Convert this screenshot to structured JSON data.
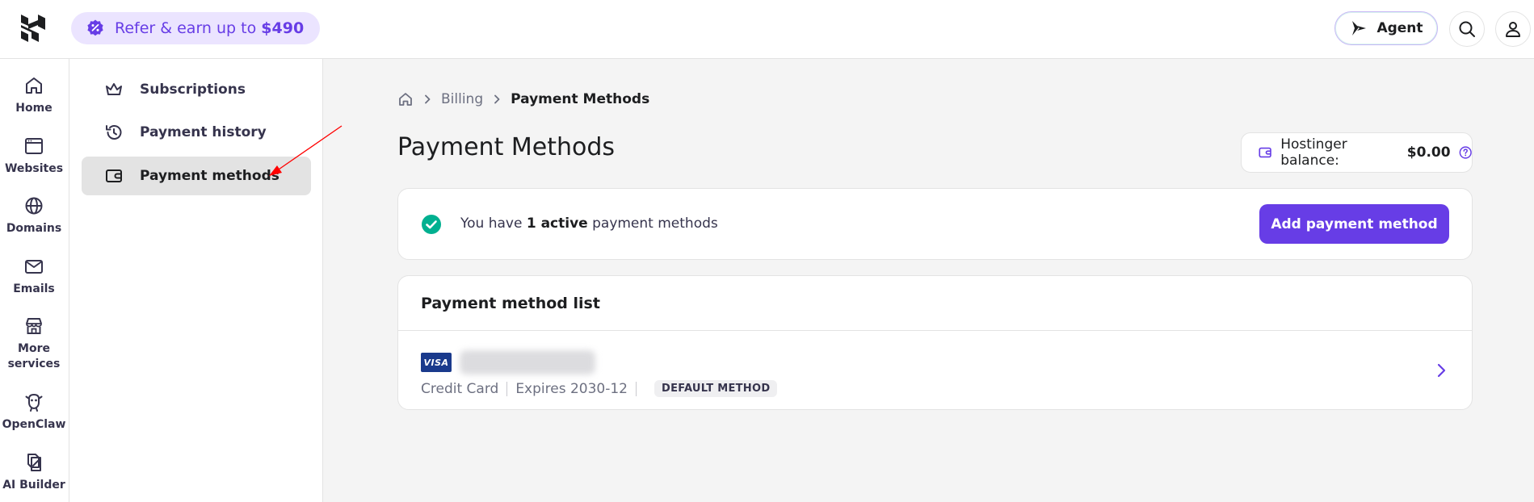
{
  "topbar": {
    "refer": {
      "prefix": "Refer & earn up to ",
      "amount": "$490"
    },
    "agent_label": "Agent"
  },
  "rail": {
    "items": [
      {
        "label": "Home",
        "icon": "home-icon"
      },
      {
        "label": "Websites",
        "icon": "browser-window-icon"
      },
      {
        "label": "Domains",
        "icon": "globe-icon"
      },
      {
        "label": "Emails",
        "icon": "mail-icon"
      },
      {
        "label": "More",
        "label2": "services",
        "icon": "store-icon"
      },
      {
        "label": "OpenClaw",
        "icon": "openclaw-icon"
      },
      {
        "label": "AI Builder",
        "icon": "ai-builder-icon"
      }
    ]
  },
  "subnav": {
    "items": [
      {
        "label": "Subscriptions",
        "icon": "crown-icon"
      },
      {
        "label": "Payment history",
        "icon": "history-icon"
      },
      {
        "label": "Payment methods",
        "icon": "wallet-icon",
        "active": true
      }
    ]
  },
  "breadcrumb": {
    "parent": "Billing",
    "current": "Payment Methods"
  },
  "page": {
    "title": "Payment Methods",
    "balance_label": "Hostinger balance:",
    "balance_amount": "$0.00"
  },
  "status": {
    "prefix": "You have ",
    "count_text": "1 active",
    "suffix": " payment methods",
    "add_button": "Add payment method"
  },
  "list": {
    "title": "Payment method list",
    "methods": [
      {
        "brand": "VISA",
        "type": "Credit Card",
        "expires": "Expires 2030-12",
        "badge": "DEFAULT METHOD"
      }
    ]
  },
  "colors": {
    "accent": "#673de6",
    "success": "#00b090",
    "annotation_arrow": "#ff0000"
  }
}
